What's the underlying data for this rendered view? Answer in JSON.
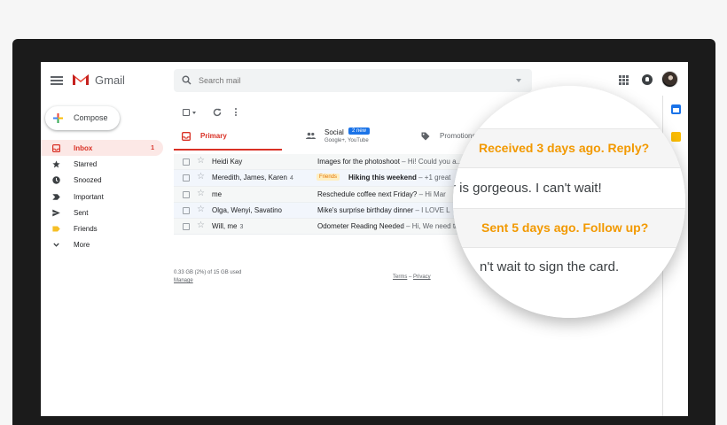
{
  "header": {
    "brand": "Gmail",
    "search_placeholder": "Search mail"
  },
  "colors": {
    "accent_red": "#d93025",
    "nudge_orange": "#f29900",
    "badge_blue": "#1a73e8"
  },
  "sidebar": {
    "compose_label": "Compose",
    "items": [
      {
        "label": "Inbox",
        "count": "1",
        "icon": "inbox-icon"
      },
      {
        "label": "Starred",
        "icon": "star-icon"
      },
      {
        "label": "Snoozed",
        "icon": "clock-icon"
      },
      {
        "label": "Important",
        "icon": "important-icon"
      },
      {
        "label": "Sent",
        "icon": "send-icon"
      },
      {
        "label": "Friends",
        "icon": "label-icon"
      },
      {
        "label": "More",
        "icon": "chevron-down-icon"
      }
    ]
  },
  "tabs": {
    "primary": "Primary",
    "social": "Social",
    "social_badge": "2 new",
    "social_sub": "Google+, YouTube",
    "promotions": "Promotions"
  },
  "emails": [
    {
      "sender": "Heidi Kay",
      "count": "",
      "label": "",
      "subject": "Images for the photoshoot",
      "snippet": " – Hi! Could you a..."
    },
    {
      "sender": "Meredith, James, Karen",
      "count": "4",
      "label": "Friends",
      "subject": "Hiking this weekend",
      "snippet": " – +1 great"
    },
    {
      "sender": "me",
      "count": "",
      "label": "",
      "subject": "Reschedule coffee next Friday?",
      "snippet": " – Hi Mar"
    },
    {
      "sender": "Olga, Wenyi, Savatino",
      "count": "",
      "label": "",
      "subject": "Mike's surprise birthday dinner",
      "snippet": " – I LOVE L"
    },
    {
      "sender": "Will, me",
      "count": "3",
      "label": "",
      "subject": "Odometer Reading Needed",
      "snippet": " – Hi, We need th"
    }
  ],
  "footer": {
    "usage": "0.33 GB (2%) of 15 GB used",
    "manage": "Manage",
    "terms": "Terms",
    "separator": " – ",
    "privacy": "Privacy"
  },
  "magnifier": {
    "nudge_1": "Received 3 days ago. Reply?",
    "snippet_1": "r is gorgeous.  I can't wait!",
    "nudge_2": "Sent 5 days ago. Follow up?",
    "snippet_2": "n't wait to sign the card."
  }
}
